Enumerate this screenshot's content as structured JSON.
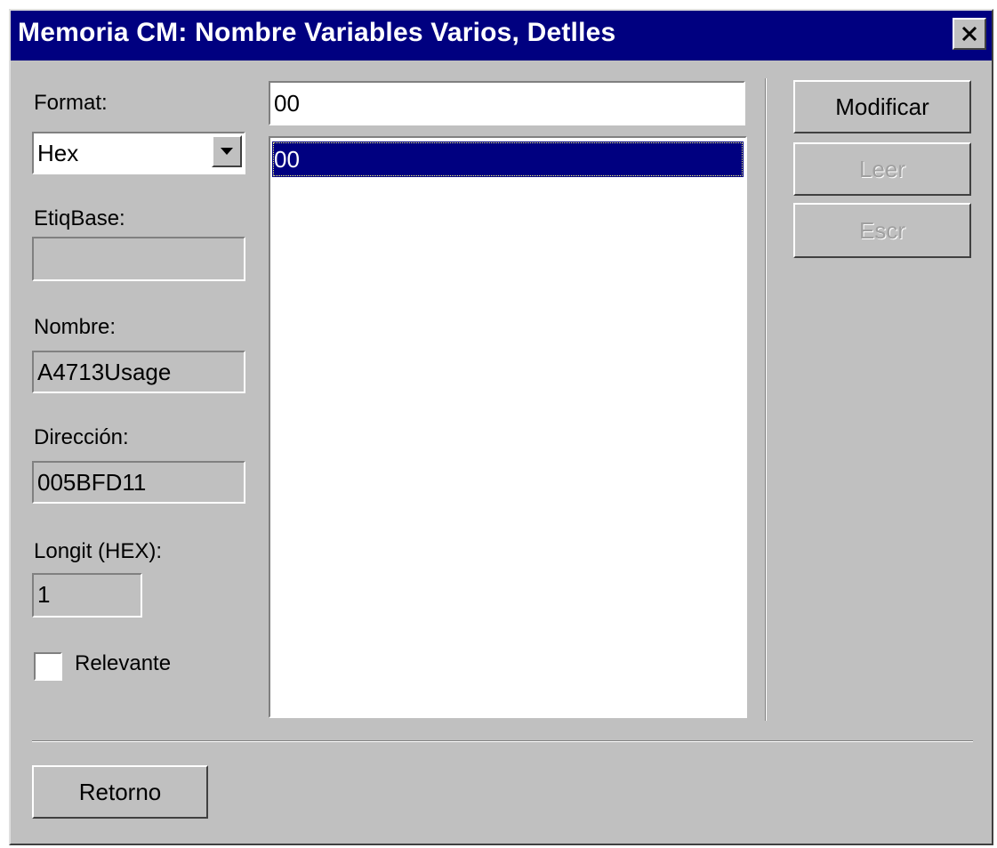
{
  "window": {
    "title": "Memoria CM: Nombre Variables Varios, Detlles",
    "close_icon": "close-icon"
  },
  "left_panel": {
    "format_label": "Format:",
    "format_value": "Hex",
    "etiqbase_label": "EtiqBase:",
    "etiqbase_value": "",
    "nombre_label": "Nombre:",
    "nombre_value": "A4713Usage",
    "direccion_label": "Dirección:",
    "direccion_value": "005BFD11",
    "longit_label": "Longit (HEX):",
    "longit_value": "1",
    "relevante_label": "Relevante",
    "relevante_checked": false
  },
  "center_panel": {
    "value_input": "00",
    "list_items": [
      "00"
    ],
    "selected_index": 0
  },
  "buttons": {
    "modificar": "Modificar",
    "leer": "Leer",
    "escr": "Escr",
    "retorno": "Retorno"
  },
  "colors": {
    "titlebar": "#000080",
    "dialog_face": "#c0c0c0",
    "selection": "#000080"
  }
}
